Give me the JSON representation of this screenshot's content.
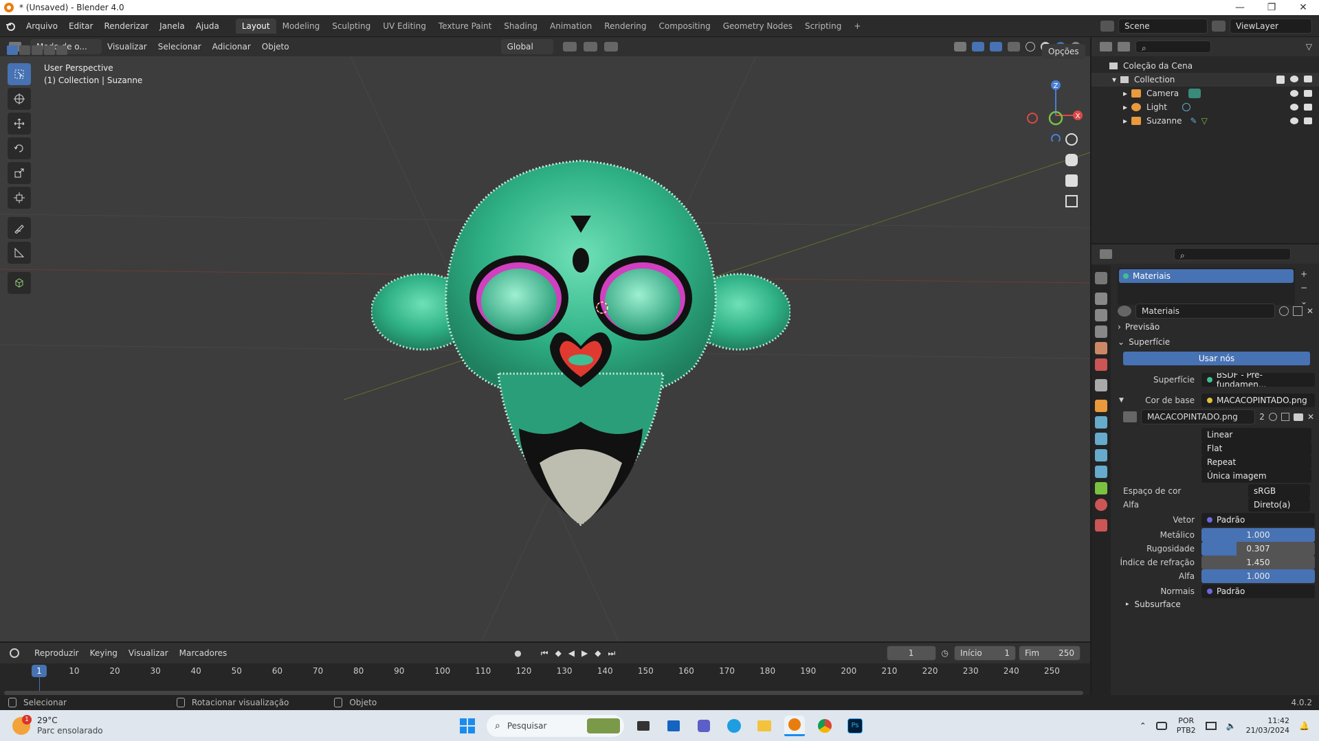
{
  "window": {
    "title": "* (Unsaved) - Blender 4.0",
    "controls": [
      "—",
      "❐",
      "✕"
    ]
  },
  "menu": {
    "items": [
      "Arquivo",
      "Editar",
      "Renderizar",
      "Janela",
      "Ajuda"
    ]
  },
  "workspaces": {
    "tabs": [
      "Layout",
      "Modeling",
      "Sculpting",
      "UV Editing",
      "Texture Paint",
      "Shading",
      "Animation",
      "Rendering",
      "Compositing",
      "Geometry Nodes",
      "Scripting"
    ],
    "add": "+",
    "active": "Layout"
  },
  "scene": {
    "name": "Scene",
    "view_layer": "ViewLayer"
  },
  "viewport": {
    "mode": "Modo de o...",
    "menus": [
      "Visualizar",
      "Selecionar",
      "Adicionar",
      "Objeto"
    ],
    "orientation": "Global",
    "options": "Opções",
    "overlay_title": "User Perspective",
    "overlay_sub": "(1) Collection | Suzanne",
    "gizmo": {
      "z": "Z",
      "x": "X",
      "y": "Y"
    }
  },
  "outliner": {
    "root": "Coleção da Cena",
    "collection": "Collection",
    "items": [
      "Camera",
      "Light",
      "Suzanne"
    ]
  },
  "properties": {
    "slot": "Materiais",
    "material_name": "Materiais",
    "previsao": "Previsão",
    "superficie_section": "Superfície",
    "use_nodes": "Usar nós",
    "surface_label": "Superfície",
    "surface_value": "BSDF - Pré-fundamen...",
    "base_color_label": "Cor de base",
    "base_color_value": "MACACOPINTADO.png",
    "image_name": "MACACOPINTADO.png",
    "image_users": "2",
    "interp": "Linear",
    "projection": "Flat",
    "extension": "Repeat",
    "source": "Única imagem",
    "color_space_label": "Espaço de cor",
    "color_space_value": "sRGB",
    "alpha_mode_label": "Alfa",
    "alpha_mode_value": "Direto(a)",
    "vector_label": "Vetor",
    "vector_value": "Padrão",
    "metallic_label": "Metálico",
    "metallic_value": "1.000",
    "metallic_fill": 1.0,
    "roughness_label": "Rugosidade",
    "roughness_value": "0.307",
    "roughness_fill": 0.307,
    "ior_label": "Índice de refração",
    "ior_value": "1.450",
    "alpha_label": "Alfa",
    "alpha_value": "1.000",
    "alpha_fill": 1.0,
    "normals_label": "Normais",
    "normals_value": "Padrão",
    "subsurface": "Subsurface"
  },
  "timeline": {
    "menus": [
      "Reproduzir",
      "Keying",
      "Visualizar",
      "Marcadores"
    ],
    "current_frame": "1",
    "start_label": "Início",
    "start": "1",
    "end_label": "Fim",
    "end": "250",
    "ticks": [
      "1",
      "10",
      "20",
      "30",
      "40",
      "50",
      "60",
      "70",
      "80",
      "90",
      "100",
      "110",
      "120",
      "130",
      "140",
      "150",
      "160",
      "170",
      "180",
      "190",
      "200",
      "210",
      "220",
      "230",
      "240",
      "250"
    ]
  },
  "status": {
    "select": "Selecionar",
    "rotate": "Rotacionar visualização",
    "object": "Objeto",
    "version": "4.0.2"
  },
  "taskbar": {
    "weather_temp": "29°C",
    "weather_desc": "Parc ensolarado",
    "search_placeholder": "Pesquisar",
    "lang1": "POR",
    "lang2": "PTB2",
    "time": "11:42",
    "date": "21/03/2024",
    "badge": "1"
  },
  "colors": {
    "accent": "#4772b3",
    "suzanne": "#3fbf93",
    "blender_orange": "#e87d0d"
  }
}
